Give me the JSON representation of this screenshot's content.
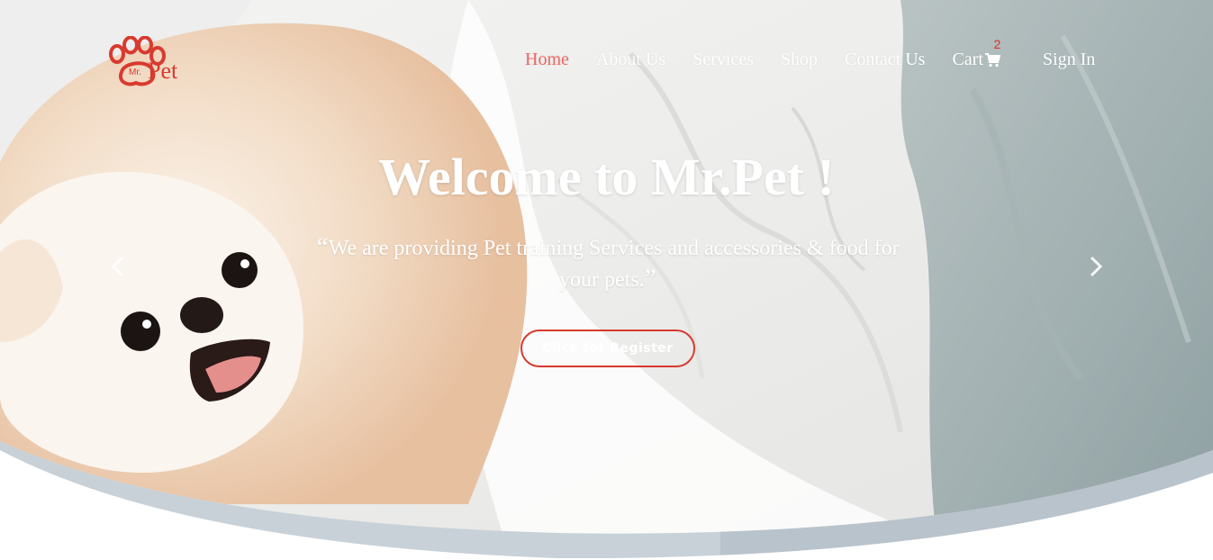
{
  "brand": {
    "logo_small_text": "Mr.",
    "logo_text": "Pet",
    "color": "#d93a2f"
  },
  "nav": {
    "items": [
      {
        "label": "Home",
        "active": true
      },
      {
        "label": "About Us",
        "active": false
      },
      {
        "label": "Services",
        "active": false
      },
      {
        "label": "Shop",
        "active": false
      },
      {
        "label": "Contact Us",
        "active": false
      }
    ],
    "cart_label": "Cart",
    "cart_icon": "shopping-cart-icon",
    "cart_count": "2",
    "signin_label": "Sign In",
    "active_color": "#ea6b66"
  },
  "hero": {
    "title": "Welcome to Mr.Pet !",
    "subtitle_open_quote": "“",
    "subtitle": "We are providing Pet training Services and accessories & food for your pets.",
    "subtitle_close_quote": "”",
    "cta_label": "Click for Register",
    "cta_border_color": "#d73a2e",
    "prev_icon": "chevron-left-icon",
    "next_icon": "chevron-right-icon"
  }
}
